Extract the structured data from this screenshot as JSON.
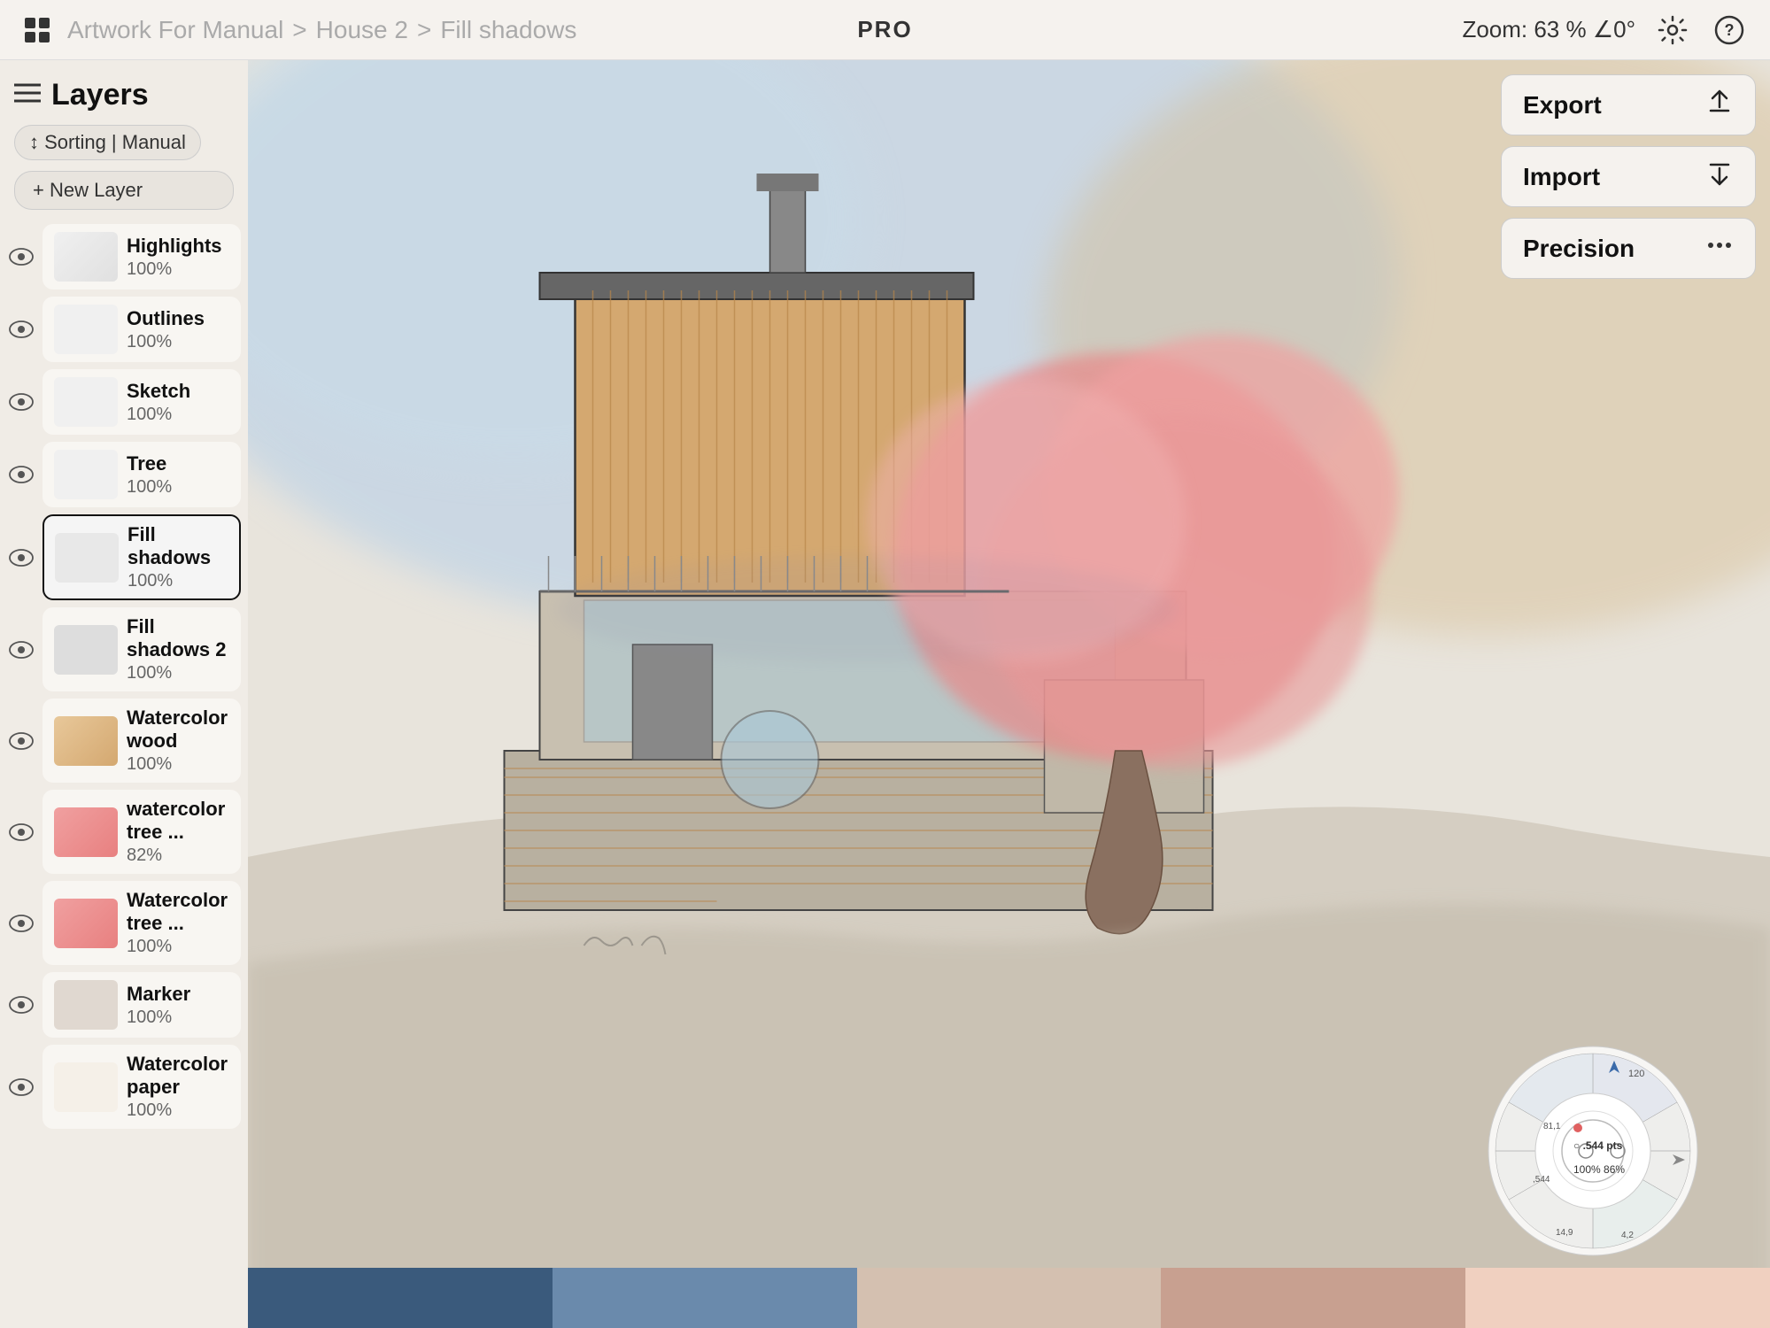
{
  "header": {
    "grid_icon": "⊞",
    "breadcrumb": {
      "part1": "Artwork For Manual",
      "sep1": ">",
      "part2": "House 2",
      "sep2": ">",
      "part3": "Fill shadows"
    },
    "pro_label": "PRO",
    "zoom_label": "Zoom:  63 %  ∠0°",
    "gear_icon": "⚙",
    "help_icon": "?"
  },
  "sidebar": {
    "hamburger": "≡",
    "title": "Layers",
    "sorting_label": "↕ Sorting | Manual",
    "new_layer_label": "+ New Layer",
    "layers": [
      {
        "name": "Highlights",
        "opacity": "100%",
        "visible": true,
        "active": false,
        "thumb_class": "thumb-highlights"
      },
      {
        "name": "Outlines",
        "opacity": "100%",
        "visible": true,
        "active": false,
        "thumb_class": "thumb-outlines"
      },
      {
        "name": "Sketch",
        "opacity": "100%",
        "visible": true,
        "active": false,
        "thumb_class": "thumb-sketch"
      },
      {
        "name": "Tree",
        "opacity": "100%",
        "visible": true,
        "active": false,
        "thumb_class": "thumb-tree"
      },
      {
        "name": "Fill shadows",
        "opacity": "100%",
        "visible": true,
        "active": true,
        "thumb_class": "thumb-fillshadows"
      },
      {
        "name": "Fill shadows 2",
        "opacity": "100%",
        "visible": true,
        "active": false,
        "thumb_class": "thumb-fillshadows2"
      },
      {
        "name": "Watercolor wood",
        "opacity": "100%",
        "visible": true,
        "active": false,
        "thumb_class": "thumb-wcwood"
      },
      {
        "name": "watercolor tree ...",
        "opacity": "82%",
        "visible": true,
        "active": false,
        "thumb_class": "thumb-wctree"
      },
      {
        "name": "Watercolor tree ...",
        "opacity": "100%",
        "visible": true,
        "active": false,
        "thumb_class": "thumb-wctree2"
      },
      {
        "name": "Marker",
        "opacity": "100%",
        "visible": true,
        "active": false,
        "thumb_class": "thumb-marker"
      },
      {
        "name": "Watercolor paper",
        "opacity": "100%",
        "visible": true,
        "active": false,
        "thumb_class": "thumb-wcpaper"
      }
    ]
  },
  "right_panel": {
    "export_label": "Export",
    "export_icon": "↑",
    "import_label": "Import",
    "import_icon": "↓",
    "precision_label": "Precision",
    "precision_icon": "⋯"
  },
  "precision_wheel": {
    "pts_label": ".544 pts",
    "pct1": "100%",
    "pct2": "86%",
    "numbers": [
      "120",
      "81,1",
      ",544",
      "14,9",
      "4,2"
    ]
  },
  "color_swatches": [
    "#3a5a7c",
    "#6a8aac",
    "#d4c0b0",
    "#c8a090",
    "#f0d0c0"
  ]
}
